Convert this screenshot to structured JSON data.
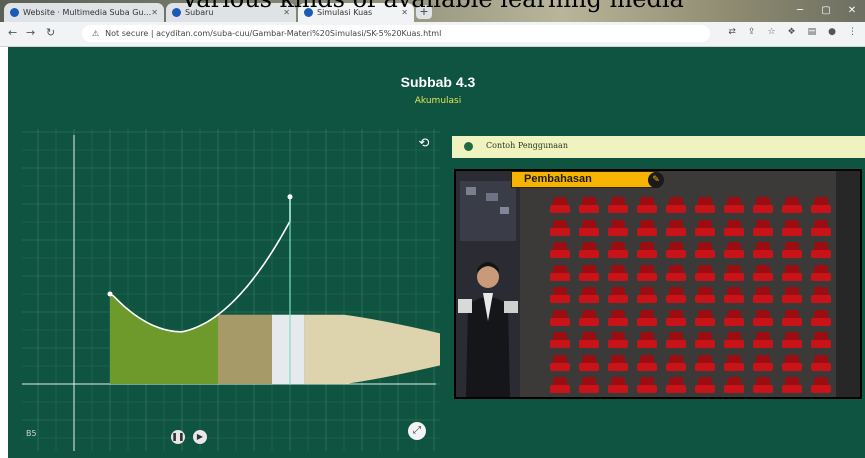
{
  "caption": "Various kinds of available learning media",
  "browser": {
    "tabs": [
      {
        "title": "Website · Multimedia Suba Gu...",
        "active": false
      },
      {
        "title": "Subaru",
        "active": false
      },
      {
        "title": "Simulasi Kuas",
        "active": true
      }
    ],
    "new_tab": "+",
    "address_warning": "Not secure",
    "address": "acyditan.com/suba-cuu/Gambar-Materi%20Simulasi/SK-5%20Kuas.html"
  },
  "page": {
    "title": "Subbab 4.3",
    "subtitle": "Akumulasi",
    "panel_label": "Contoh Penggunaan",
    "banner": "Pembahasan",
    "corner_label": "B5"
  },
  "graph": {
    "x_range": [
      -1,
      11
    ],
    "y_range": [
      -2,
      12
    ],
    "curve_start": [
      1,
      5
    ],
    "curve_end": [
      6,
      10.4
    ],
    "shaded_from": 1,
    "shaded_to": 4
  },
  "seats": {
    "rows": 9,
    "cols": 10
  },
  "colors": {
    "page_bg": "#0f5440",
    "title": "#ffffff",
    "subtitle": "#e2e45a",
    "banner": "#f6b400",
    "seat": "#c81418",
    "area": "#6d9a2a"
  }
}
